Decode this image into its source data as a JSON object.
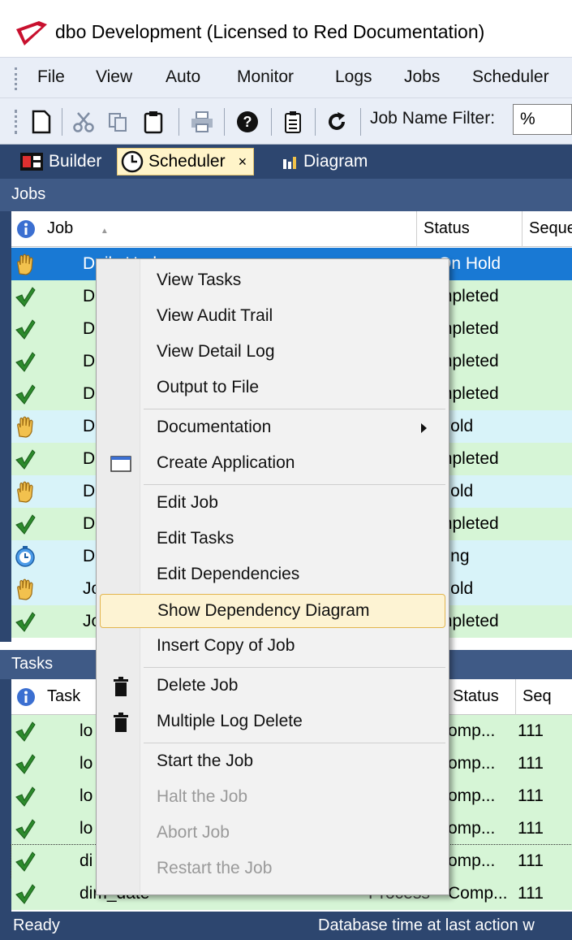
{
  "window": {
    "title": "dbo  Development  (Licensed to Red Documentation)"
  },
  "menu": [
    "File",
    "View",
    "Auto",
    "Monitor",
    "Logs",
    "Jobs",
    "Scheduler"
  ],
  "toolbar": {
    "filter_label": "Job Name Filter:",
    "filter_value": "%"
  },
  "tabs": [
    {
      "label": "Builder",
      "icon": "builder-icon"
    },
    {
      "label": "Scheduler",
      "icon": "clock-icon",
      "close": "×"
    },
    {
      "label": "Diagram",
      "icon": "bar-chart-icon"
    }
  ],
  "jobs_panel": {
    "title": "Jobs",
    "columns": [
      "Job",
      "Status",
      "Seque"
    ],
    "sort_indicator": "▲",
    "rows": [
      {
        "icon": "hand",
        "job": "Daily Upd",
        "status": "On Hold",
        "selected": true
      },
      {
        "icon": "check",
        "job": "D",
        "status": "mpleted"
      },
      {
        "icon": "check",
        "job": "D",
        "status": "mpleted"
      },
      {
        "icon": "check",
        "job": "D",
        "status": "mpleted"
      },
      {
        "icon": "check",
        "job": "D",
        "status": "mpleted"
      },
      {
        "icon": "hand",
        "job": "D",
        "status": "Hold"
      },
      {
        "icon": "check",
        "job": "D",
        "status": "mpleted"
      },
      {
        "icon": "hand",
        "job": "D",
        "status": "Hold"
      },
      {
        "icon": "check",
        "job": "D",
        "status": "mpleted"
      },
      {
        "icon": "wait",
        "job": "D",
        "status": "iting"
      },
      {
        "icon": "hand",
        "job": "Jo",
        "status": "Hold"
      },
      {
        "icon": "check",
        "job": "Jo",
        "status": "mpleted"
      }
    ]
  },
  "tasks_panel": {
    "title": "Tasks",
    "columns": [
      "Task",
      "Status",
      "Seq"
    ],
    "rows": [
      {
        "icon": "check",
        "task": "lo",
        "status": "omp...",
        "seq": "111"
      },
      {
        "icon": "check",
        "task": "lo",
        "status": "omp...",
        "seq": "111"
      },
      {
        "icon": "check",
        "task": "lo",
        "status": "omp...",
        "seq": "111"
      },
      {
        "icon": "check",
        "task": "lo",
        "status": "omp...",
        "seq": "111"
      },
      {
        "icon": "check",
        "task": "di",
        "status": "omp...",
        "seq": "111",
        "focused": true
      },
      {
        "icon": "check",
        "task": "dim_date",
        "action": "Process",
        "status": "Comp...",
        "seq": "111"
      }
    ]
  },
  "status_bar": {
    "left": "Ready",
    "right": "Database time at last action w"
  },
  "context_menu": {
    "items": [
      {
        "label": "View Tasks"
      },
      {
        "label": "View Audit Trail"
      },
      {
        "label": "View Detail Log"
      },
      {
        "label": "Output to File"
      },
      {
        "sep": true
      },
      {
        "label": "Documentation",
        "submenu": true
      },
      {
        "label": "Create Application",
        "icon": "window-icon"
      },
      {
        "sep": true
      },
      {
        "label": "Edit Job"
      },
      {
        "label": "Edit Tasks"
      },
      {
        "label": "Edit Dependencies"
      },
      {
        "label": "Show Dependency Diagram",
        "highlight": true
      },
      {
        "label": "Insert Copy of Job"
      },
      {
        "sep": true
      },
      {
        "label": "Delete Job",
        "icon": "trash-icon"
      },
      {
        "label": "Multiple Log Delete",
        "icon": "trash-icon"
      },
      {
        "sep": true
      },
      {
        "label": "Start the Job"
      },
      {
        "label": "Halt the Job",
        "disabled": true
      },
      {
        "label": "Abort Job",
        "disabled": true
      },
      {
        "label": "Restart the Job",
        "disabled": true
      }
    ]
  },
  "colors": {
    "navy": "#2d466f",
    "panel_header": "#3f5a86",
    "row_green": "#d6f5d6",
    "row_blue": "#d8f3f9",
    "selection": "#1979d4",
    "menu_highlight": "#fdf3d3"
  }
}
